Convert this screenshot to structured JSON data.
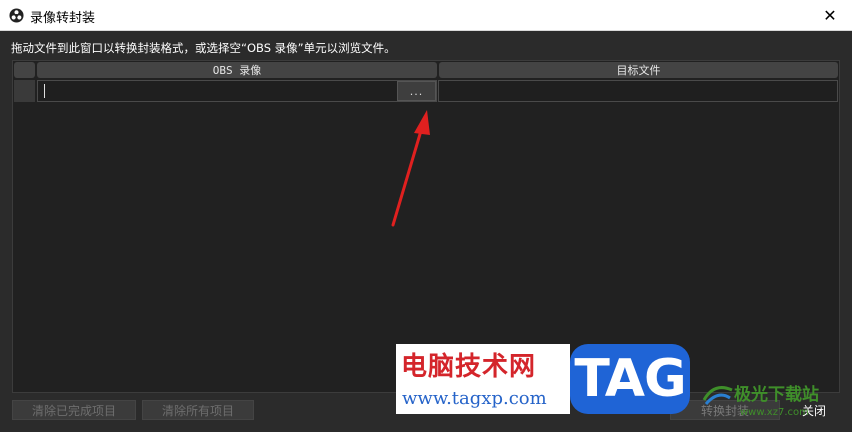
{
  "window": {
    "title": "录像转封装",
    "close_glyph": "✕"
  },
  "hint_text": "拖动文件到此窗口以转换封装格式，或选择空“OBS 录像”单元以浏览文件。",
  "table": {
    "columns": [
      "OBS 录像",
      "目标文件"
    ],
    "rows": [
      {
        "obs_recording": "",
        "target_file": ""
      }
    ],
    "browse_label": "..."
  },
  "buttons": {
    "clear_completed": "清除已完成项目",
    "clear_all": "清除所有项目",
    "remux": "转换封装",
    "close": "关闭"
  },
  "watermarks": {
    "site_name": "电脑技术网",
    "site_url": "www.tagxp.com",
    "logo_text": "TAG",
    "right_name": "极光下载站",
    "right_url": "www.xz7.com"
  },
  "colors": {
    "titlebar": "#ffffff",
    "window_bg": "#2b2b2b",
    "table_bg": "#212121",
    "header_bg": "#444444",
    "annotation_arrow": "#e0201f",
    "logo_blue": "#1f64d6",
    "site_red": "#d4252b"
  }
}
